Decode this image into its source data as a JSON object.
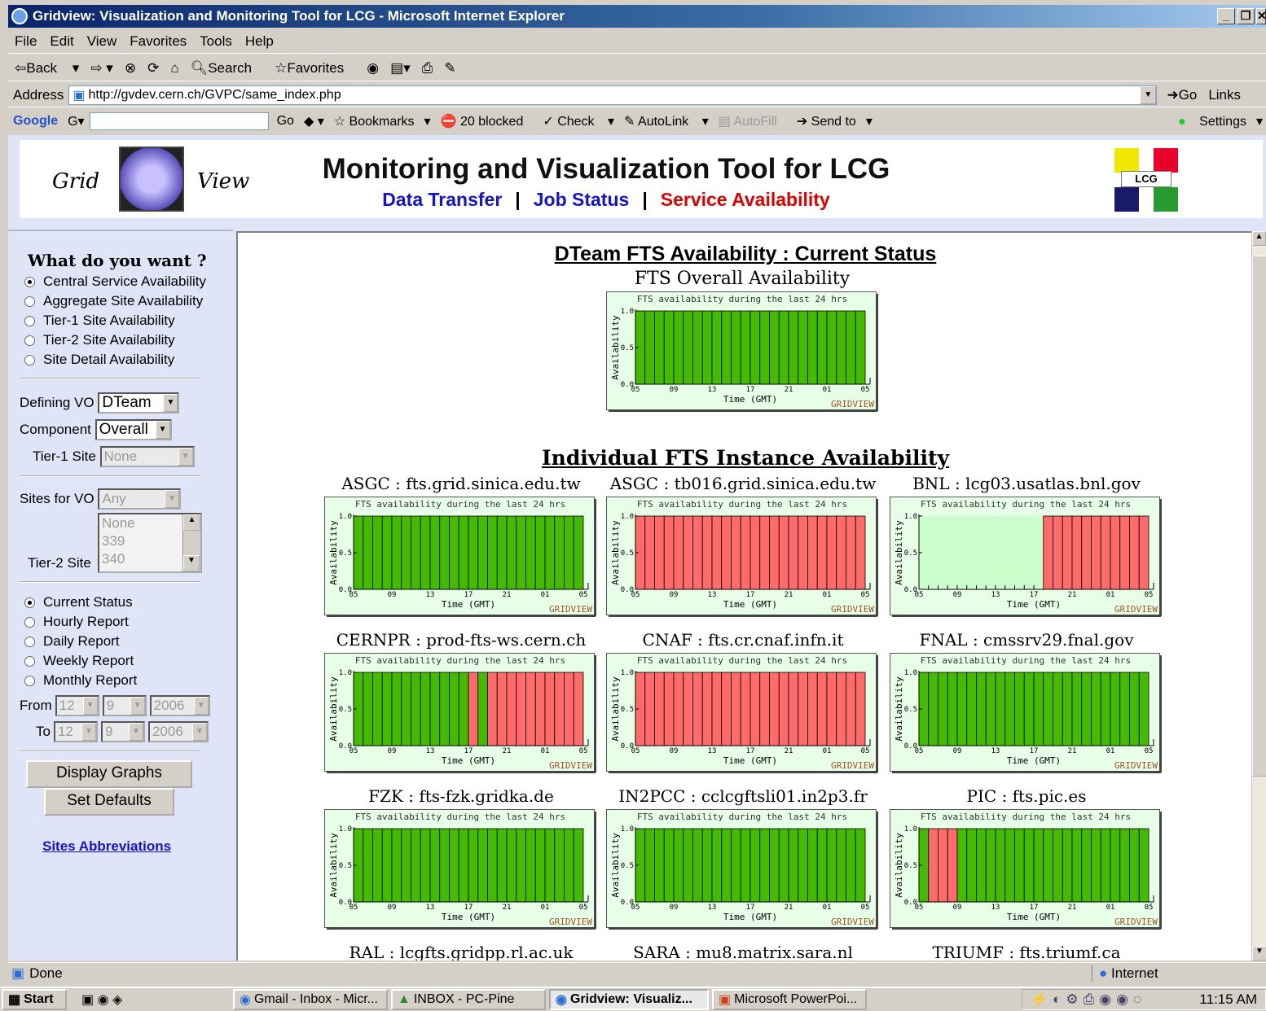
{
  "window": {
    "title": "Gridview: Visualization and Monitoring Tool for LCG - Microsoft Internet Explorer"
  },
  "menu": [
    "File",
    "Edit",
    "View",
    "Favorites",
    "Tools",
    "Help"
  ],
  "toolbar": {
    "back": "Back",
    "search": "Search",
    "favorites": "Favorites"
  },
  "address": {
    "label": "Address",
    "url": "http://gvdev.cern.ch/GVPC/same_index.php",
    "go": "Go",
    "links": "Links"
  },
  "googlebar": {
    "logo": "Google",
    "go": "Go",
    "bookmarks": "Bookmarks",
    "blocked": "20 blocked",
    "check": "Check",
    "autolink": "AutoLink",
    "autofill": "AutoFill",
    "sendto": "Send to",
    "settings": "Settings"
  },
  "header": {
    "logo_left": "Grid",
    "logo_right": "View",
    "title": "Monitoring and Visualization Tool for LCG",
    "nav": {
      "data_transfer": "Data Transfer",
      "job_status": "Job Status",
      "service_availability": "Service Availability",
      "separator": "|"
    },
    "lcg_logo": "LCG"
  },
  "sidebar": {
    "heading": "What do you want ?",
    "availability_options": [
      "Central Service Availability",
      "Aggregate Site Availability",
      "Tier-1 Site Availability",
      "Tier-2 Site Availability",
      "Site Detail Availability"
    ],
    "defining_vo_label": "Defining VO",
    "defining_vo": "DTeam",
    "component_label": "Component",
    "component": "Overall",
    "tier1_label": "Tier-1 Site",
    "tier1": "None",
    "sites_for_vo_label": "Sites for VO",
    "sites_for_vo": "Any",
    "tier2_label": "Tier-2 Site",
    "tier2_list": [
      "None",
      "339",
      "340"
    ],
    "report_options": [
      "Current Status",
      "Hourly Report",
      "Daily Report",
      "Weekly Report",
      "Monthly Report"
    ],
    "from_label": "From",
    "to_label": "To",
    "from_date": {
      "month": "12",
      "day": "9",
      "year": "2006"
    },
    "to_date": {
      "month": "12",
      "day": "9",
      "year": "2006"
    },
    "display_button": "Display Graphs",
    "defaults_button": "Set Defaults",
    "abbrev_link": "Sites Abbreviations"
  },
  "content": {
    "section1_title": "DTeam FTS Availability : Current Status",
    "overall_title": "FTS Overall Availability",
    "section2_title": "Individual FTS Instance Availability",
    "bottom_row": [
      "RAL : lcgfts.gridpp.rl.ac.uk",
      "SARA : mu8.matrix.sara.nl",
      "TRIUMF : fts.triumf.ca"
    ]
  },
  "chart_common": {
    "subtitle": "FTS availability during the last 24 hrs",
    "ylabel": "Availability",
    "xlabel": "Time (GMT)",
    "watermark": "GRIDVIEW",
    "yticks": [
      "0.0",
      "0.5",
      "1.0"
    ],
    "xticks": [
      "05",
      "09",
      "13",
      "17",
      "21",
      "01",
      "05"
    ],
    "colors": {
      "up": "#44bb00",
      "down": "#ff6a6a",
      "bg": "#ccffcc",
      "frame": "#e6ffe6"
    }
  },
  "chart_data": [
    {
      "type": "bar",
      "title": "FTS Overall Availability",
      "status": [
        "u",
        "u",
        "u",
        "u",
        "u",
        "u",
        "u",
        "u",
        "u",
        "u",
        "u",
        "u",
        "u",
        "u",
        "u",
        "u",
        "u",
        "u",
        "u",
        "u",
        "u",
        "u",
        "u",
        "u"
      ],
      "ylim": [
        0,
        1
      ]
    },
    {
      "type": "bar",
      "title": "ASGC : fts.grid.sinica.edu.tw",
      "status": [
        "u",
        "u",
        "u",
        "u",
        "u",
        "u",
        "u",
        "u",
        "u",
        "u",
        "u",
        "u",
        "u",
        "u",
        "u",
        "u",
        "u",
        "u",
        "u",
        "u",
        "u",
        "u",
        "u",
        "u"
      ],
      "ylim": [
        0,
        1
      ]
    },
    {
      "type": "bar",
      "title": "ASGC : tb016.grid.sinica.edu.tw",
      "status": [
        "d",
        "d",
        "d",
        "d",
        "d",
        "d",
        "d",
        "d",
        "d",
        "d",
        "d",
        "d",
        "d",
        "d",
        "d",
        "d",
        "d",
        "d",
        "d",
        "d",
        "d",
        "d",
        "d",
        "d"
      ],
      "ylim": [
        0,
        1
      ]
    },
    {
      "type": "bar",
      "title": "BNL : lcg03.usatlas.bnl.gov",
      "status": [
        "n",
        "n",
        "n",
        "n",
        "n",
        "n",
        "n",
        "n",
        "n",
        "n",
        "n",
        "n",
        "n",
        "d",
        "d",
        "d",
        "d",
        "d",
        "d",
        "d",
        "d",
        "d",
        "d",
        "d"
      ],
      "ylim": [
        0,
        1
      ]
    },
    {
      "type": "bar",
      "title": "CERNPR : prod-fts-ws.cern.ch",
      "status": [
        "u",
        "u",
        "u",
        "u",
        "u",
        "u",
        "u",
        "u",
        "u",
        "u",
        "u",
        "u",
        "d",
        "u",
        "d",
        "d",
        "d",
        "d",
        "d",
        "d",
        "d",
        "d",
        "d",
        "d"
      ],
      "ylim": [
        0,
        1
      ]
    },
    {
      "type": "bar",
      "title": "CNAF : fts.cr.cnaf.infn.it",
      "status": [
        "d",
        "d",
        "d",
        "d",
        "d",
        "d",
        "d",
        "d",
        "d",
        "d",
        "d",
        "d",
        "d",
        "d",
        "d",
        "d",
        "d",
        "d",
        "d",
        "d",
        "d",
        "d",
        "d",
        "d"
      ],
      "ylim": [
        0,
        1
      ]
    },
    {
      "type": "bar",
      "title": "FNAL : cmssrv29.fnal.gov",
      "status": [
        "u",
        "u",
        "u",
        "u",
        "u",
        "u",
        "u",
        "u",
        "u",
        "u",
        "u",
        "u",
        "u",
        "u",
        "u",
        "u",
        "u",
        "u",
        "u",
        "u",
        "u",
        "u",
        "u",
        "u"
      ],
      "ylim": [
        0,
        1
      ]
    },
    {
      "type": "bar",
      "title": "FZK : fts-fzk.gridka.de",
      "status": [
        "u",
        "u",
        "u",
        "u",
        "u",
        "u",
        "u",
        "u",
        "u",
        "u",
        "u",
        "u",
        "u",
        "u",
        "u",
        "u",
        "u",
        "u",
        "u",
        "u",
        "u",
        "u",
        "u",
        "u"
      ],
      "ylim": [
        0,
        1
      ]
    },
    {
      "type": "bar",
      "title": "IN2PCC : cclcgftsli01.in2p3.fr",
      "status": [
        "u",
        "u",
        "u",
        "u",
        "u",
        "u",
        "u",
        "u",
        "u",
        "u",
        "u",
        "u",
        "u",
        "u",
        "u",
        "u",
        "u",
        "u",
        "u",
        "u",
        "u",
        "u",
        "u",
        "u"
      ],
      "ylim": [
        0,
        1
      ]
    },
    {
      "type": "bar",
      "title": "PIC : fts.pic.es",
      "status": [
        "u",
        "d",
        "d",
        "d",
        "u",
        "u",
        "u",
        "u",
        "u",
        "u",
        "u",
        "u",
        "u",
        "u",
        "u",
        "u",
        "u",
        "u",
        "u",
        "u",
        "u",
        "u",
        "u",
        "u"
      ],
      "ylim": [
        0,
        1
      ]
    }
  ],
  "status": {
    "left": "Done",
    "zone": "Internet"
  },
  "taskbar": {
    "start": "Start",
    "tasks": [
      "Gmail - Inbox - Micr...",
      "INBOX - PC-Pine",
      "Gridview: Visualiz...",
      "Microsoft PowerPoi..."
    ],
    "clock": "11:15 AM"
  }
}
